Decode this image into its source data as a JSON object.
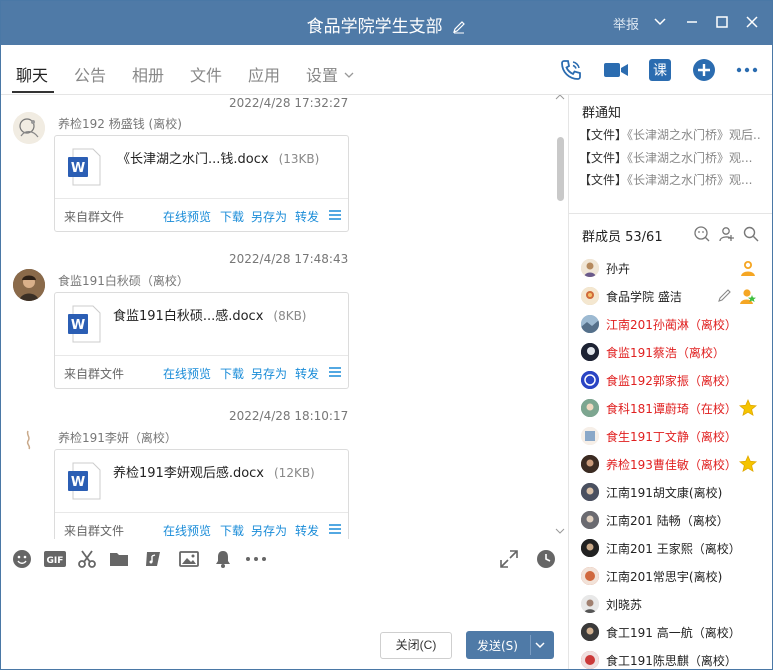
{
  "window": {
    "title": "食品学院学生支部",
    "report_label": "举报"
  },
  "tabs": [
    {
      "label": "聊天",
      "active": true
    },
    {
      "label": "公告"
    },
    {
      "label": "相册"
    },
    {
      "label": "文件"
    },
    {
      "label": "应用"
    },
    {
      "label": "设置"
    }
  ],
  "messages": [
    {
      "time": "2022/4/28 17:32:27",
      "sender": "养检192 杨盛钱 (离校)",
      "file_name": "《长津湖之水门...钱.docx",
      "file_size": "(13KB)",
      "source": "来自群文件",
      "actions": [
        "在线预览",
        "下载",
        "另存为",
        "转发"
      ]
    },
    {
      "time": "2022/4/28 17:48:43",
      "sender": "食监191白秋硕（离校）",
      "file_name": "食监191白秋硕...感.docx",
      "file_size": "(8KB)",
      "source": "来自群文件",
      "actions": [
        "在线预览",
        "下载",
        "另存为",
        "转发"
      ]
    },
    {
      "time": "2022/4/28 18:10:17",
      "sender": "养检191李妍（离校）",
      "file_name": "养检191李妍观后感.docx",
      "file_size": "(12KB)",
      "source": "来自群文件",
      "actions": [
        "在线预览",
        "下载",
        "另存为",
        "转发"
      ]
    }
  ],
  "buttons": {
    "close": "关闭(C)",
    "send": "发送(S)"
  },
  "notice": {
    "title": "群通知",
    "items": [
      {
        "tag": "【文件】",
        "text": "《长津湖之水门桥》观后..."
      },
      {
        "tag": "【文件】",
        "text": "《长津湖之水门桥》观..."
      },
      {
        "tag": "【文件】",
        "text": "《长津湖之水门桥》观..."
      }
    ]
  },
  "members": {
    "title": "群成员 53/61",
    "list": [
      {
        "name": "孙卉",
        "red": false,
        "badge": "owner-icon"
      },
      {
        "name": "食品学院 盛洁",
        "red": false,
        "badge": "admin-icon",
        "edit": true
      },
      {
        "name": "江南201孙蔺淋（离校）",
        "red": true
      },
      {
        "name": "食监191蔡浩（离校）",
        "red": true
      },
      {
        "name": "食监192郭家振（离校）",
        "red": true
      },
      {
        "name": "食科181谭蔚琦（在校）",
        "red": true,
        "badge": "star-icon"
      },
      {
        "name": "食生191丁文静（离校）",
        "red": true
      },
      {
        "name": "养检193曹佳敏（离校）",
        "red": true,
        "badge": "star-icon"
      },
      {
        "name": "江南191胡文康(离校)",
        "red": false
      },
      {
        "name": "江南201 陆畅（离校）",
        "red": false
      },
      {
        "name": "江南201 王家熙（离校）",
        "red": false
      },
      {
        "name": "江南201常思宇(离校)",
        "red": false
      },
      {
        "name": "刘晓苏",
        "red": false
      },
      {
        "name": "食工191 高一航（离校）",
        "red": false
      },
      {
        "name": "食工191陈思麒（离校）",
        "red": false
      }
    ]
  },
  "colors": {
    "titlebar": "#4f7aa7",
    "link": "#1a8cd8",
    "red_name": "#e02020",
    "word_blue": "#2b5eb4"
  }
}
